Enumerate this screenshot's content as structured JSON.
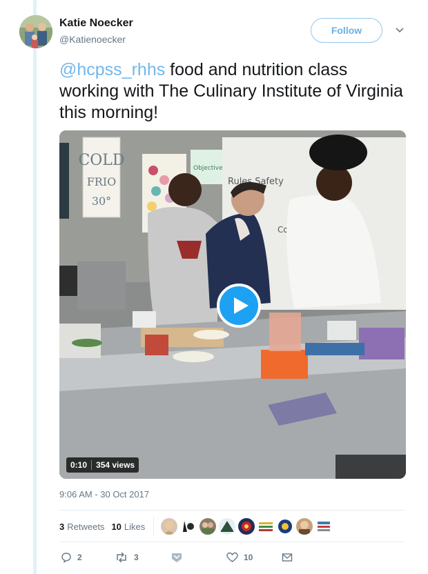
{
  "author": {
    "name": "Katie Noecker",
    "handle": "@Katienoecker",
    "follow_label": "Follow"
  },
  "tweet": {
    "mention": "@hcpss_rhhs",
    "text": " food and nutrition class working with The Culinary Institute of Virginia this morning!",
    "timestamp": "9:06 AM - 30 Oct 2017"
  },
  "video": {
    "duration": "0:10",
    "views": "354 views",
    "scene_signs": {
      "cold": "COLD",
      "frio": "FRIO",
      "temp": "30°",
      "board_objective": "Objective:",
      "board_line1": "Rules Safety",
      "board_line2": "Cooking"
    }
  },
  "stats": {
    "retweets_count": "3",
    "retweets_label": "Retweets",
    "likes_count": "10",
    "likes_label": "Likes"
  },
  "actions": {
    "replies": "2",
    "retweets": "3",
    "likes": "10"
  },
  "colors": {
    "accent": "#1da1f2",
    "mention": "#72b7ec",
    "muted": "#657786"
  }
}
